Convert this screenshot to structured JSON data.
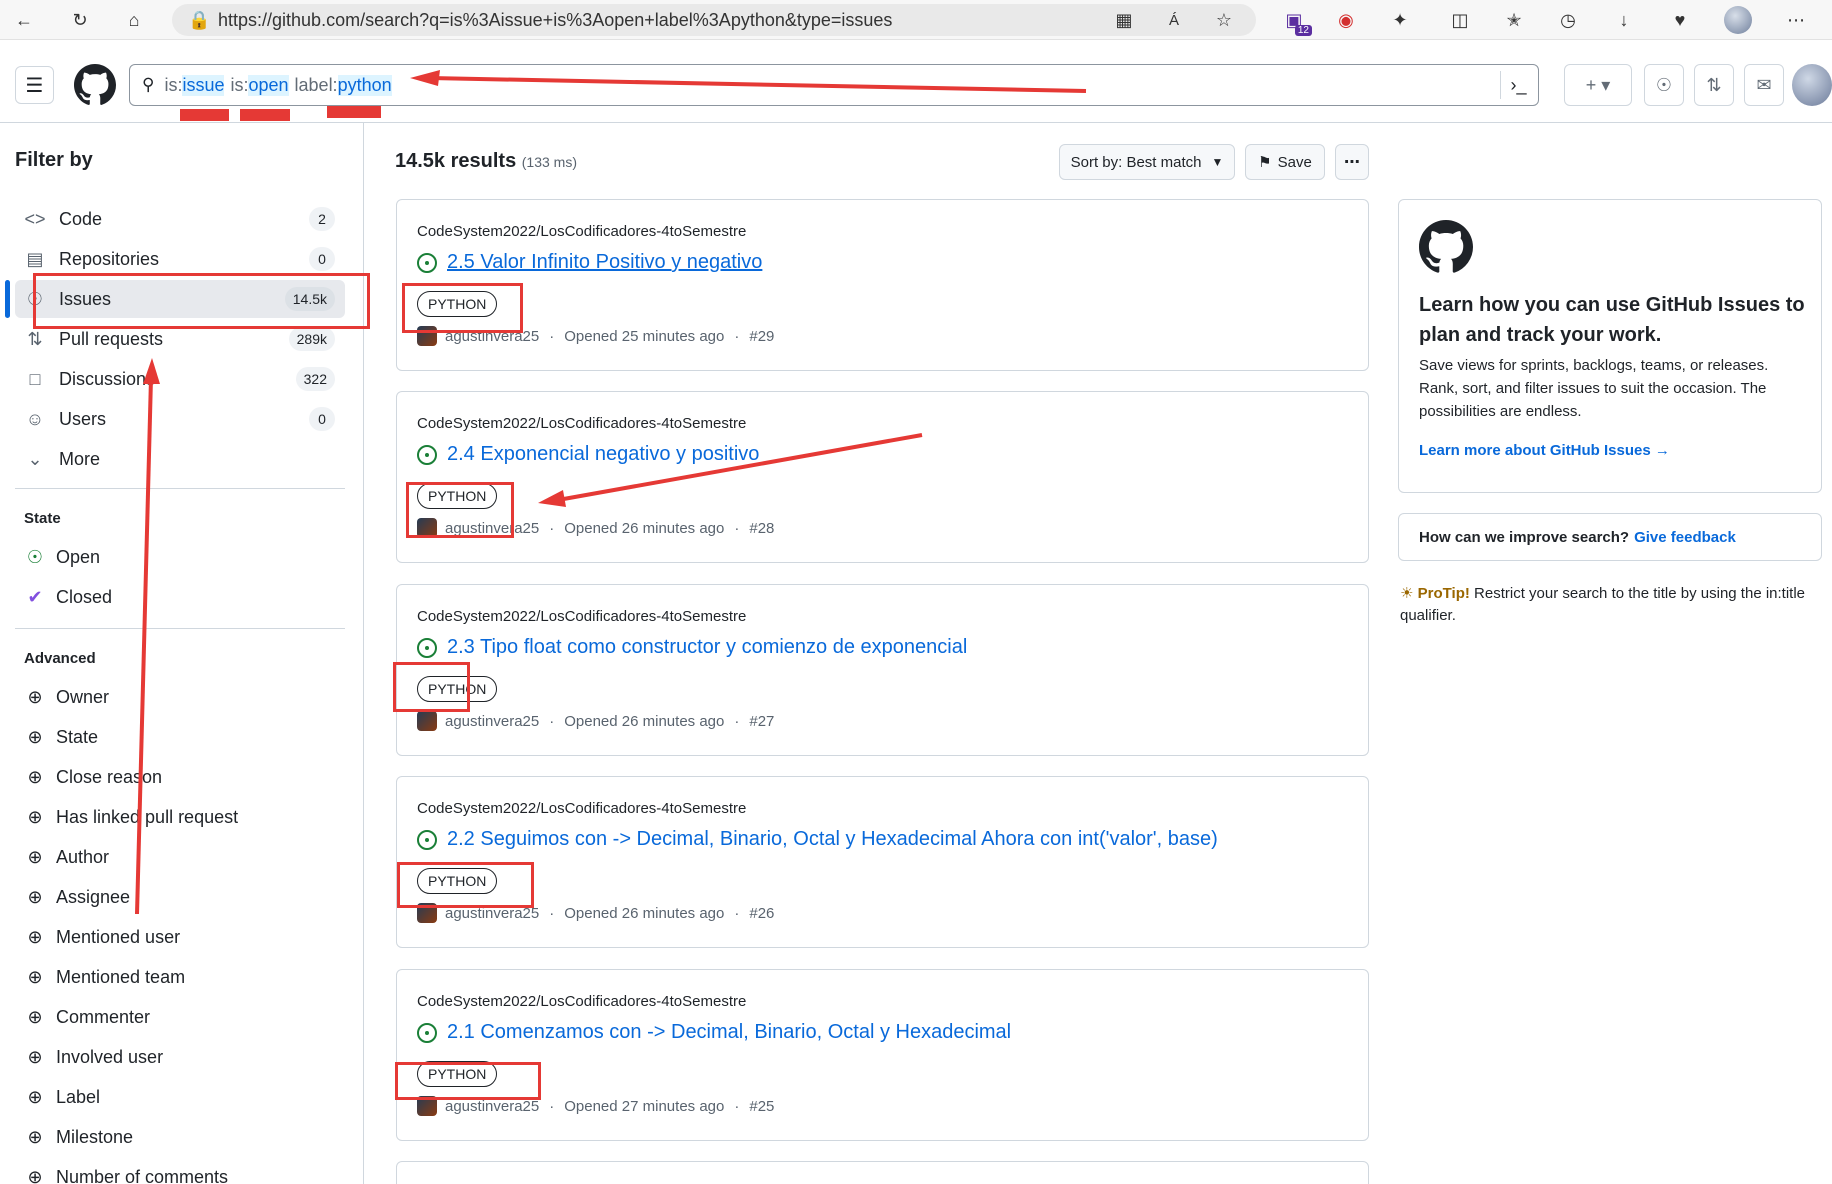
{
  "browser": {
    "url": "https://github.com/search?q=is%3Aissue+is%3Aopen+label%3Apython&type=issues",
    "ext_badge": "12"
  },
  "header": {
    "query": [
      {
        "key": "is:",
        "val": "issue"
      },
      {
        "key": "is:",
        "val": "open"
      },
      {
        "key": "label:",
        "val": "python"
      }
    ]
  },
  "sidebar": {
    "title": "Filter by",
    "nav": [
      {
        "label": "Code",
        "count": "2",
        "icon": "code-icon"
      },
      {
        "label": "Repositories",
        "count": "0",
        "icon": "repo-icon"
      },
      {
        "label": "Issues",
        "count": "14.5k",
        "icon": "issue-icon"
      },
      {
        "label": "Pull requests",
        "count": "289k",
        "icon": "pull-request-icon"
      },
      {
        "label": "Discussions",
        "count": "322",
        "icon": "discussion-icon"
      },
      {
        "label": "Users",
        "count": "0",
        "icon": "people-icon"
      },
      {
        "label": "More",
        "icon": "chevron-down-icon"
      }
    ],
    "state_title": "State",
    "state": [
      "Open",
      "Closed"
    ],
    "advanced_title": "Advanced",
    "advanced": [
      "Owner",
      "State",
      "Close reason",
      "Has linked pull request",
      "Author",
      "Assignee",
      "Mentioned user",
      "Mentioned team",
      "Commenter",
      "Involved user",
      "Label",
      "Milestone",
      "Number of comments"
    ]
  },
  "results": {
    "count": "14.5k results",
    "time": "(133 ms)",
    "sort_label": "Sort by: Best match",
    "save_label": "Save",
    "items": [
      {
        "repo": "CodeSystem2022/LosCodificadores-4toSemestre",
        "title": "2.5 Valor Infinito Positivo y negativo",
        "label": "PYTHON",
        "author": "agustinvera25",
        "opened": "Opened 25 minutes ago",
        "number": "#29"
      },
      {
        "repo": "CodeSystem2022/LosCodificadores-4toSemestre",
        "title": "2.4 Exponencial negativo y positivo",
        "label": "PYTHON",
        "author": "agustinvera25",
        "opened": "Opened 26 minutes ago",
        "number": "#28"
      },
      {
        "repo": "CodeSystem2022/LosCodificadores-4toSemestre",
        "title": "2.3 Tipo float como constructor y comienzo de exponencial",
        "label": "PYTHON",
        "author": "agustinvera25",
        "opened": "Opened 26 minutes ago",
        "number": "#27"
      },
      {
        "repo": "CodeSystem2022/LosCodificadores-4toSemestre",
        "title": "2.2 Seguimos con -> Decimal, Binario, Octal y Hexadecimal Ahora con int('valor', base)",
        "label": "PYTHON",
        "author": "agustinvera25",
        "opened": "Opened 26 minutes ago",
        "number": "#26"
      },
      {
        "repo": "CodeSystem2022/LosCodificadores-4toSemestre",
        "title": "2.1 Comenzamos con -> Decimal, Binario, Octal y Hexadecimal",
        "label": "PYTHON",
        "author": "agustinvera25",
        "opened": "Opened 27 minutes ago",
        "number": "#25"
      }
    ]
  },
  "aside": {
    "heading": "Learn how you can use GitHub Issues to plan and track your work.",
    "desc": "Save views for sprints, backlogs, teams, or releases. Rank, sort, and filter issues to suit the occasion. The possibilities are endless.",
    "learn_link": "Learn more about GitHub Issues",
    "feedback_q": "How can we improve search?",
    "feedback_link": "Give feedback",
    "protip_label": "ProTip!",
    "protip_text": " Restrict your search to the title by using the in:title qualifier."
  },
  "colors": {
    "accent": "#0969da",
    "open": "#1a7f37",
    "annotation": "#e53935"
  }
}
